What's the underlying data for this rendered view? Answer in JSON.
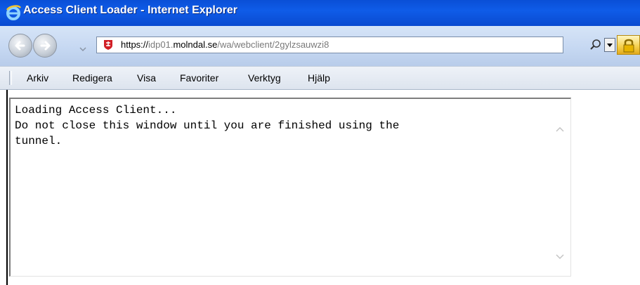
{
  "window": {
    "title": "Access Client Loader - Internet Explorer",
    "icon": "ie-logo-icon"
  },
  "address_bar": {
    "url_scheme": "https://",
    "url_subdomain": "idp01.",
    "url_domain": "molndal.se",
    "url_path": "/wa/webclient/2gylzsauwzi8",
    "site_icon": "site-shield-icon",
    "lock_icon": "padlock-icon"
  },
  "menu": {
    "items": [
      "Arkiv",
      "Redigera",
      "Visa",
      "Favoriter",
      "Verktyg",
      "Hjälp"
    ]
  },
  "content": {
    "textarea_text": "Loading Access Client...\nDo not close this window until you are finished using the\ntunnel."
  },
  "colors": {
    "titlebar": "#0f5ce8",
    "toolbar": "#c6d8f2",
    "lock": "#f5cf4a"
  }
}
